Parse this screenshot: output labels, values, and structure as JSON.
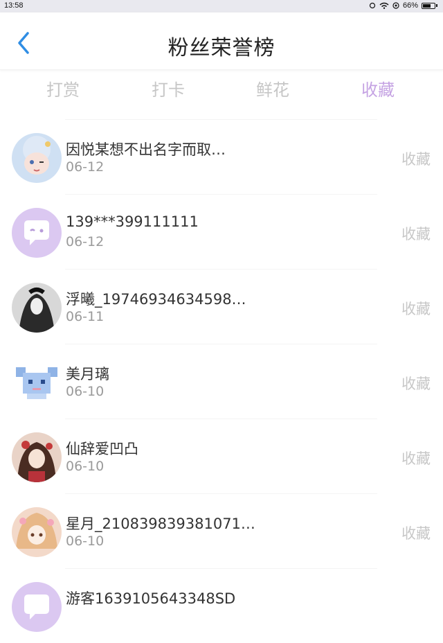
{
  "status_bar": {
    "time": "13:58",
    "battery": "66%",
    "battery_level": 0.66
  },
  "header": {
    "title": "粉丝荣誉榜"
  },
  "tabs": [
    {
      "label": "打赏"
    },
    {
      "label": "打卡"
    },
    {
      "label": "鲜花"
    },
    {
      "label": "收藏",
      "active": true
    }
  ],
  "list": [
    {
      "name": "因悦某想不出名字而取…",
      "date": "06-12",
      "action": "收藏"
    },
    {
      "name": "139***399111111",
      "date": "06-12",
      "action": "收藏"
    },
    {
      "name": "浮曦_19746934634598…",
      "date": "06-11",
      "action": "收藏"
    },
    {
      "name": "美月璃",
      "date": "06-10",
      "action": "收藏"
    },
    {
      "name": "仙辞爱凹凸",
      "date": "06-10",
      "action": "收藏"
    },
    {
      "name": "星月_210839839381071…",
      "date": "06-10",
      "action": "收藏"
    },
    {
      "name": "游客1639105643348SD",
      "date": "",
      "action": ""
    }
  ],
  "colors": {
    "accent": "#c5a3e3",
    "inactive": "#c6c6c6",
    "back": "#2f8de4"
  }
}
